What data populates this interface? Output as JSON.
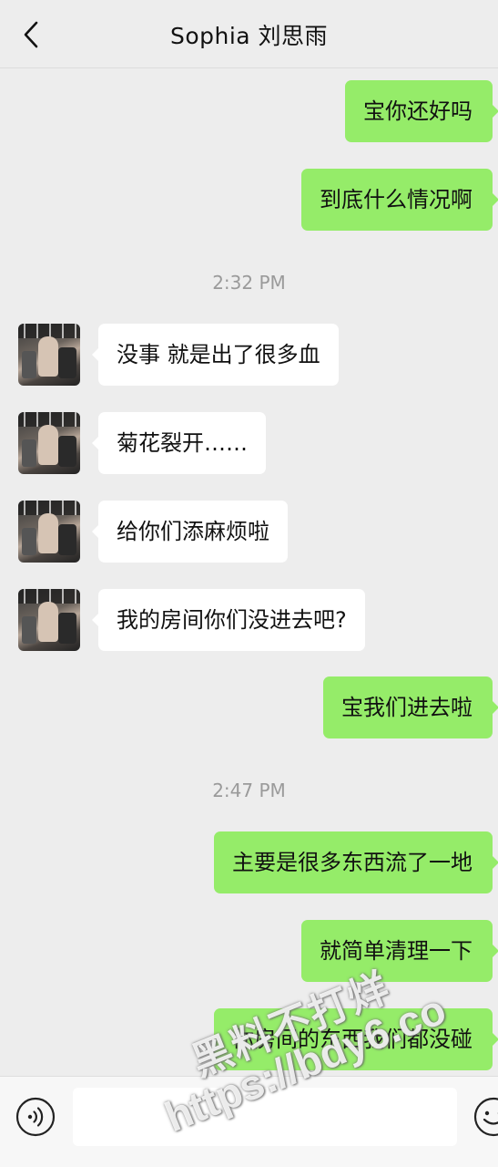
{
  "header": {
    "title": "Sophia 刘思雨",
    "back_icon": "chevron-left-icon"
  },
  "messages": [
    {
      "side": "out",
      "text": "宝你还好吗"
    },
    {
      "side": "out",
      "text": "到底什么情况啊"
    },
    {
      "type": "time",
      "text": "2:32 PM"
    },
    {
      "side": "in",
      "text": "没事 就是出了很多血"
    },
    {
      "side": "in",
      "text": "菊花裂开……"
    },
    {
      "side": "in",
      "text": "给你们添麻烦啦"
    },
    {
      "side": "in",
      "text": "我的房间你们没进去吧?"
    },
    {
      "side": "out",
      "text": "宝我们进去啦"
    },
    {
      "type": "time",
      "text": "2:47 PM"
    },
    {
      "side": "out",
      "text": "主要是很多东西流了一地"
    },
    {
      "side": "out",
      "text": "就简单清理一下"
    },
    {
      "side": "out",
      "text": "你房间的东西我们都没碰"
    }
  ],
  "input_bar": {
    "voice_icon": "voice-icon",
    "input_value": "",
    "emoji_icon": "emoji-icon"
  },
  "watermark": {
    "line1": "黑料不打烊",
    "line2": "https://bdy6.co"
  },
  "colors": {
    "outgoing_bubble": "#95ec69",
    "incoming_bubble": "#ffffff",
    "background": "#ededed"
  }
}
